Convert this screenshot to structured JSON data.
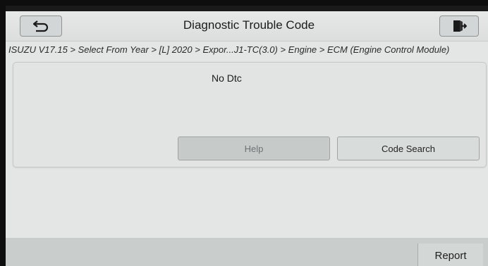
{
  "header": {
    "title": "Diagnostic Trouble Code",
    "back_icon": "back-arrow-icon",
    "exit_icon": "exit-door-icon"
  },
  "breadcrumb": "ISUZU V17.15 > Select From Year > [L] 2020 > Expor...J1-TC(3.0) > Engine > ECM (Engine Control Module)",
  "main": {
    "dtc_status": "No Dtc",
    "help_label": "Help",
    "code_search_label": "Code Search"
  },
  "footer": {
    "report_label": "Report"
  }
}
